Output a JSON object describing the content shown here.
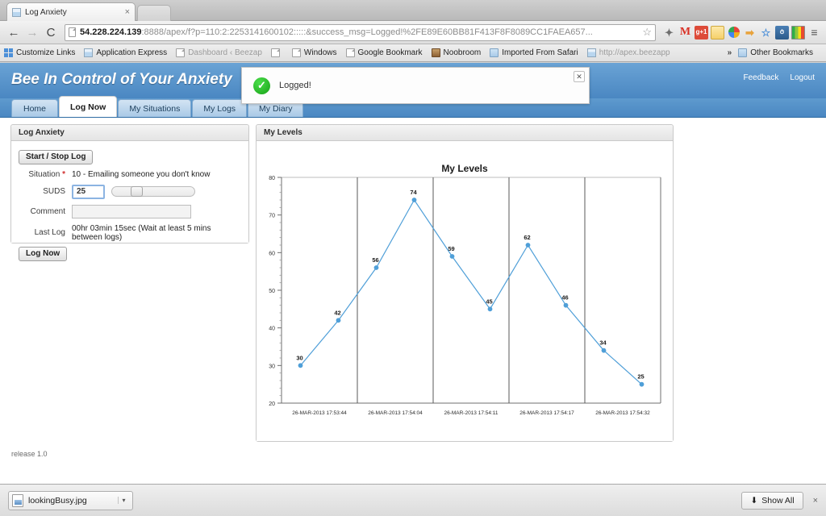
{
  "browser": {
    "tab": {
      "title": "Log Anxiety",
      "close_label": "×",
      "favicon": "page-favicon"
    },
    "nav": {
      "back": "←",
      "forward": "→",
      "reload": "C"
    },
    "omnibox": {
      "host": "54.228.224.139",
      "rest": ":8888/apex/f?p=110:2:2253141600102:::::&success_msg=Logged!%2FE89E60BB81F413F8F8089CC1FAEA657...",
      "star": "☆"
    },
    "extensions": [
      {
        "name": "wand-icon",
        "glyph": "✦"
      },
      {
        "name": "gmail-icon",
        "glyph": "M"
      },
      {
        "name": "google-plus-one-icon",
        "glyph": "g+1"
      },
      {
        "name": "folder-icon",
        "glyph": ""
      },
      {
        "name": "picasa-icon",
        "glyph": ""
      },
      {
        "name": "send-to-phone-icon",
        "glyph": "➡"
      },
      {
        "name": "blue-star-icon",
        "glyph": "☆"
      },
      {
        "name": "speed-gauge-icon",
        "glyph": ""
      },
      {
        "name": "color-palette-icon",
        "glyph": ""
      },
      {
        "name": "chrome-menu-icon",
        "glyph": "≡"
      }
    ],
    "bookmarks": [
      {
        "label": "Customize Links",
        "icon": "apps-grid-icon"
      },
      {
        "label": "Application Express",
        "icon": "window-icon"
      },
      {
        "label": "Dashboard ‹ Beezap",
        "icon": "page-icon",
        "faded": true
      },
      {
        "label": "",
        "icon": "page-icon"
      },
      {
        "label": "Windows",
        "icon": "page-icon"
      },
      {
        "label": "Google Bookmark",
        "icon": "page-icon"
      },
      {
        "label": "Noobroom",
        "icon": "noobroom-icon"
      },
      {
        "label": "Imported From Safari",
        "icon": "blue-folder-icon"
      },
      {
        "label": "http://apex.beezapp",
        "icon": "window-icon",
        "faded": true
      }
    ],
    "bookmarks_overflow": "»",
    "other_bookmarks": {
      "label": "Other Bookmarks",
      "icon": "blue-folder-icon"
    }
  },
  "app": {
    "title": "Bee In Control of Your Anxiety",
    "links": [
      "Feedback",
      "Logout"
    ],
    "tabs": [
      {
        "label": "Home",
        "active": false
      },
      {
        "label": "Log Now",
        "active": true
      },
      {
        "label": "My Situations",
        "active": false
      },
      {
        "label": "My Logs",
        "active": false
      },
      {
        "label": "My Diary",
        "active": false
      }
    ],
    "notification": {
      "message": "Logged!",
      "icon": "success-check-icon",
      "close": "✕"
    },
    "release": "release 1.0"
  },
  "form": {
    "region_title": "Log Anxiety",
    "start_stop_button": "Start / Stop Log",
    "situation": {
      "label": "Situation",
      "required": "*",
      "value": "10 - Emailing someone you don't know"
    },
    "suds": {
      "label": "SUDS",
      "value": "25",
      "slider_percent": 23
    },
    "comment": {
      "label": "Comment",
      "value": "",
      "placeholder": ""
    },
    "last_log": {
      "label": "Last Log",
      "value": "00hr 03min 15sec (Wait at least 5 mins between logs)"
    },
    "log_now_button": "Log Now"
  },
  "chart_panel": {
    "region_title": "My Levels"
  },
  "chart_data": {
    "type": "line",
    "title": "My Levels",
    "xlabel": "",
    "ylabel": "",
    "ylim": [
      20,
      80
    ],
    "yticks": [
      20,
      30,
      40,
      50,
      60,
      70,
      80
    ],
    "grid": false,
    "legend": "none",
    "series": [
      {
        "name": "My Levels",
        "color": "#4f9fd8",
        "values": [
          30,
          42,
          56,
          74,
          59,
          45,
          62,
          46,
          34,
          25
        ]
      }
    ],
    "data_labels": [
      "30",
      "42",
      "56",
      "74",
      "59",
      "45",
      "62",
      "46",
      "34",
      "25"
    ],
    "x_tick_labels": [
      "26-MAR-2013 17:53:44",
      "26-MAR-2013 17:54:04",
      "26-MAR-2013 17:54:11",
      "26-MAR-2013 17:54:17",
      "26-MAR-2013 17:54:32"
    ],
    "group_separators": 4
  },
  "shelf": {
    "download_name": "lookingBusy.jpg",
    "dropdown_arrow": "▾",
    "show_all": "Show All",
    "show_all_icon": "⬇",
    "close": "×"
  }
}
